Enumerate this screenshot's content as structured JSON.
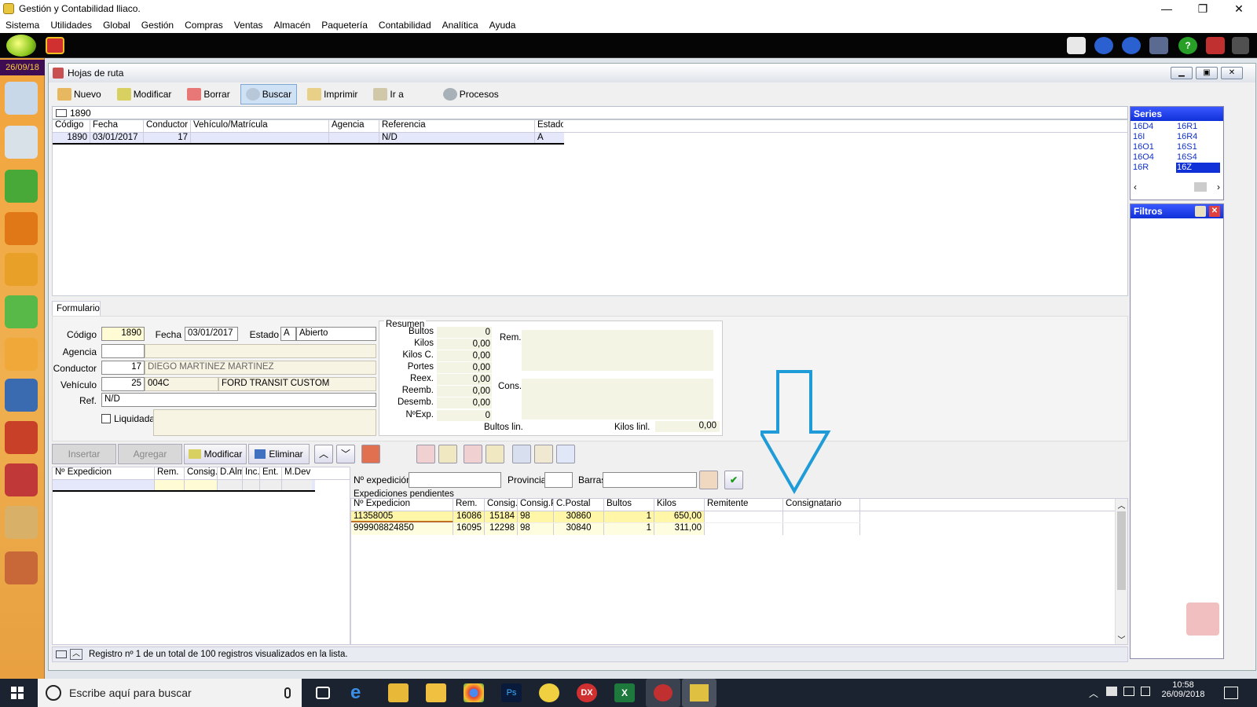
{
  "window": {
    "title": "Gestión y Contabilidad lliaco.",
    "min": "—",
    "restore": "❐",
    "close": "✕"
  },
  "menu": [
    "Sistema",
    "Utilidades",
    "Global",
    "Gestión",
    "Compras",
    "Ventas",
    "Almacén",
    "Paquetería",
    "Contabilidad",
    "Analítica",
    "Ayuda"
  ],
  "date_badge": "26/09/18",
  "child": {
    "title": "Hojas de ruta"
  },
  "toolbar": {
    "nuevo": "Nuevo",
    "modificar": "Modificar",
    "borrar": "Borrar",
    "buscar": "Buscar",
    "imprimir": "Imprimir",
    "ir_a": "Ir a",
    "procesos": "Procesos"
  },
  "search": {
    "value": "1890"
  },
  "list": {
    "headers": [
      "Código",
      "Fecha",
      "Conductor",
      "Vehículo/Matrícula",
      "Agencia",
      "Referencia",
      "Estado"
    ],
    "rows": [
      [
        "1890",
        "03/01/2017",
        "17",
        "",
        "",
        "N/D",
        "A"
      ]
    ]
  },
  "form": {
    "tab": "Formulario",
    "codigo_label": "Código",
    "codigo": "1890",
    "fecha_label": "Fecha",
    "fecha": "03/01/2017",
    "estado_label": "Estado",
    "estado_code": "A",
    "estado_text": "Abierto",
    "agencia_label": "Agencia",
    "conductor_label": "Conductor",
    "conductor": "17",
    "conductor_name": "DIEGO MARTINEZ MARTINEZ",
    "vehiculo_label": "Vehículo",
    "vehiculo": "25",
    "vehiculo_code": "004C",
    "vehiculo_name": "FORD TRANSIT CUSTOM",
    "ref_label": "Ref.",
    "ref": "N/D",
    "liquidada": "Liquidada"
  },
  "resumen": {
    "title": "Resumen",
    "items": [
      {
        "label": "Bultos",
        "value": "0"
      },
      {
        "label": "Kilos",
        "value": "0,00"
      },
      {
        "label": "Kilos C.",
        "value": "0,00"
      },
      {
        "label": "Portes",
        "value": "0,00"
      },
      {
        "label": "Reex.",
        "value": "0,00"
      },
      {
        "label": "Reemb.",
        "value": "0,00"
      },
      {
        "label": "Desemb.",
        "value": "0,00"
      },
      {
        "label": "NºExp.",
        "value": "0"
      }
    ],
    "rem": "Rem.",
    "cons": "Cons.",
    "bultos_lin": "Bultos lin.",
    "kilos_lin": "Kilos linl.",
    "kilos_lin_value": "0,00"
  },
  "buttons": {
    "insertar": "Insertar",
    "agregar": "Agregar",
    "modificar": "Modificar",
    "eliminar": "Eliminar"
  },
  "lineas": {
    "headers": [
      "Nº Expedicion",
      "Rem.",
      "Consig.",
      "D.Alm.",
      "Inc.",
      "Ent.",
      "M.Dev"
    ]
  },
  "filtro": {
    "nexp_label": "Nº expedición",
    "provincia_label": "Provincia",
    "barras_label": "Barras"
  },
  "pendientes": {
    "title": "Expediciones pendientes",
    "headers": [
      "Nº Expedicion",
      "Rem.",
      "Consig.",
      "Consig.P",
      "C.Postal",
      "Bultos",
      "Kilos",
      "Remitente",
      "Consignatario"
    ],
    "rows": [
      [
        "11358005",
        "16086",
        "15184",
        "98",
        "30860",
        "1",
        "650,00",
        "",
        ""
      ],
      [
        "999908824850",
        "16095",
        "12298",
        "98",
        "30840",
        "1",
        "311,00",
        "",
        ""
      ]
    ]
  },
  "status": {
    "text": "Registro nº 1 de un total de 100 registros visualizados en la lista."
  },
  "series": {
    "title": "Series",
    "items": [
      [
        "16D4",
        "16R1"
      ],
      [
        "16I",
        "16R4"
      ],
      [
        "16O1",
        "16S1"
      ],
      [
        "16O4",
        "16S4"
      ],
      [
        "16R",
        "16Z"
      ]
    ]
  },
  "filtros": {
    "title": "Filtros"
  },
  "taskbar": {
    "search_placeholder": "Escribe aquí para buscar",
    "time": "10:58",
    "date": "26/09/2018"
  },
  "colors": {
    "accent": "#1f9bd7",
    "selection_row": "#fff6a8",
    "panel_header": "#1030d8"
  }
}
